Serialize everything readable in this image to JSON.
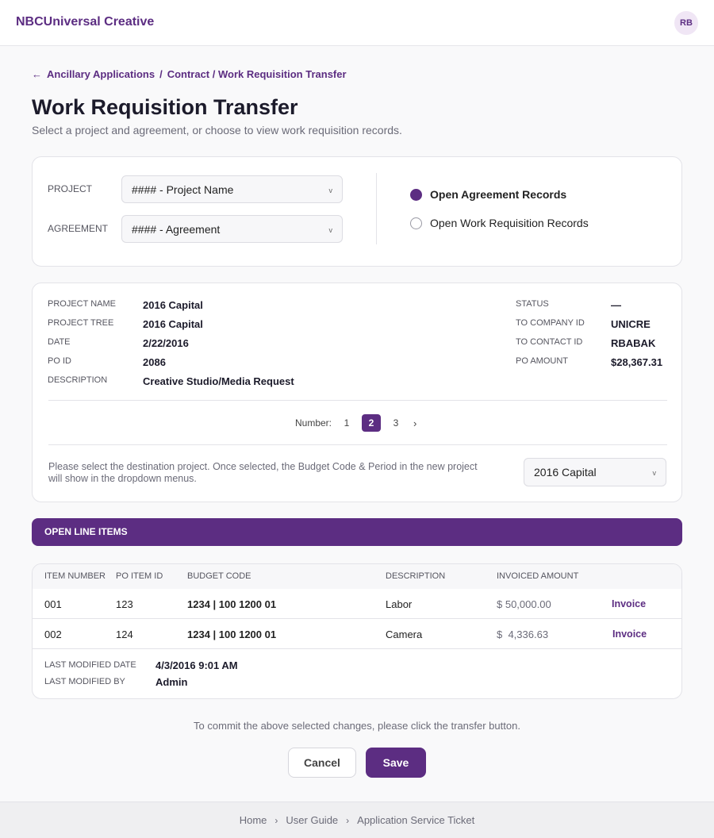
{
  "header": {
    "brand": "NBCUniversal Creative",
    "avatar_initials": "RB"
  },
  "breadcrumb": {
    "back_icon": "arrow-left-icon",
    "root": "Ancillary Applications",
    "separator": "/",
    "current": "Contract / Work Requisition Transfer"
  },
  "page": {
    "title": "Work Requisition Transfer",
    "subtitle": "Select a project and agreement, or choose to view work requisition records."
  },
  "selection": {
    "project_label": "PROJECT",
    "project_value": "#### - Project Name",
    "agreement_label": "AGREEMENT",
    "agreement_value": "#### - Agreement",
    "radio_options": [
      {
        "label": "Open Agreement Records",
        "selected": true
      },
      {
        "label": "Open Work Requisition Records",
        "selected": false
      }
    ]
  },
  "details": {
    "left": [
      {
        "label": "PROJECT NAME",
        "value": "2016 Capital"
      },
      {
        "label": "PROJECT TREE",
        "value": "2016 Capital"
      },
      {
        "label": "DATE",
        "value": "2/22/2016"
      },
      {
        "label": "PO ID",
        "value": "2086"
      },
      {
        "label": "DESCRIPTION",
        "value": "Creative Studio/Media Request"
      }
    ],
    "right": [
      {
        "label": "STATUS",
        "value": "—"
      },
      {
        "label": "TO COMPANY ID",
        "value": "UNICRE"
      },
      {
        "label": "TO CONTACT ID",
        "value": "RBABAK"
      },
      {
        "label": "PO AMOUNT",
        "value": "$28,367.31"
      }
    ],
    "pager": {
      "label": "Number:",
      "pages": [
        "1",
        "2",
        "3"
      ],
      "active": "2",
      "next": "›"
    },
    "destination_note": "Please select the destination project. Once selected, the Budget Code & Period in the new project will show in the dropdown menus.",
    "destination_value": "2016 Capital"
  },
  "line_items": {
    "banner": "OPEN LINE ITEMS",
    "columns": [
      "ITEM NUMBER",
      "PO ITEM ID",
      "BUDGET CODE",
      "DESCRIPTION",
      "INVOICED AMOUNT"
    ],
    "rows": [
      {
        "item_number": "001",
        "po_item_id": "123",
        "budget_code": "1234 | 100 1200 01",
        "description": "Labor",
        "invoiced_amount": "$ 50,000.00",
        "action": "Invoice"
      },
      {
        "item_number": "002",
        "po_item_id": "124",
        "budget_code": "1234 | 100 1200 01",
        "description": "Camera",
        "invoiced_amount": "$  4,336.63",
        "action": "Invoice"
      }
    ],
    "last_modified_date_label": "LAST MODIFIED DATE",
    "last_modified_date": "4/3/2016 9:01 AM",
    "last_modified_by_label": "LAST MODIFIED BY",
    "last_modified_by": "Admin"
  },
  "actions": {
    "commit_note": "To commit the above selected changes, please click the transfer button.",
    "cancel_label": "Cancel",
    "save_label": "Save"
  },
  "footer": {
    "links": [
      "Home",
      "User Guide",
      "Application Service Ticket"
    ],
    "separator": "›"
  },
  "colors": {
    "brand": "#5c2d82"
  }
}
